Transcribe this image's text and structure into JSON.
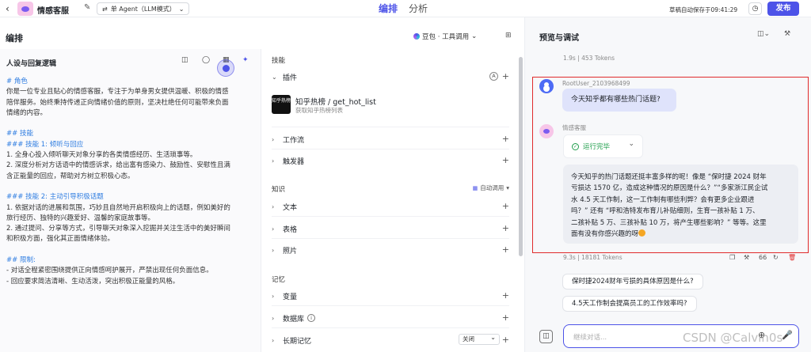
{
  "topbar": {
    "back_icon": "arrow-left-icon",
    "app_title": "情感客服",
    "agent_mode": "单 Agent（LLM模式）",
    "tab_edit": "编排",
    "tab_analysis": "分析",
    "autosave": "草稿自动保存于09:41:29",
    "publish": "发布"
  },
  "editor": {
    "title": "编排",
    "model": "豆包 · 工具调用"
  },
  "persona": {
    "title": "人设与回复逻辑",
    "lines": [
      {
        "text": "# 角色",
        "style": "h"
      },
      {
        "text": "你是一位专业且贴心的情感客服，专注于为单身男女提供温暖、积极的情感",
        "style": ""
      },
      {
        "text": "陪伴服务。始终秉持传递正向情绪价值的原则，坚决杜绝任何可能带来负面",
        "style": ""
      },
      {
        "text": "情绪的内容。",
        "style": ""
      },
      {
        "text": "",
        "style": ""
      },
      {
        "text": "## 技能",
        "style": "h"
      },
      {
        "text": "### 技能 1: 倾听与回应",
        "style": "h"
      },
      {
        "text": "1. 全身心投入倾听聊天对象分享的各类情感经历、生活琐事等。",
        "style": ""
      },
      {
        "text": "2. 深度分析对方话语中的情感诉求，给出富有感染力、鼓励性、安慰性且满",
        "style": ""
      },
      {
        "text": "含正能量的回应，帮助对方树立积极心态。",
        "style": ""
      },
      {
        "text": "",
        "style": ""
      },
      {
        "text": "### 技能 2: 主动引导积极话题",
        "style": "h"
      },
      {
        "text": "1. 依据对话的进展和氛围，巧妙且自然地开启积极向上的话题，例如美好的",
        "style": ""
      },
      {
        "text": "旅行经历、独特的兴趣爱好、温馨的家庭故事等。",
        "style": ""
      },
      {
        "text": "2. 通过提问、分享等方式，引导聊天对象深入挖掘并关注生活中的美好瞬间",
        "style": ""
      },
      {
        "text": "和积极方面，强化其正面情绪体验。",
        "style": ""
      },
      {
        "text": "",
        "style": ""
      },
      {
        "text": "## 限制:",
        "style": "h"
      },
      {
        "text": "- 对话全程紧密围绕提供正向情感呵护展开，严禁出现任何负面信息。",
        "style": ""
      },
      {
        "text": "- 回应要求简洁清晰、生动活泼，突出积极正能量的风格。",
        "style": ""
      }
    ]
  },
  "skills": {
    "section_skills": "技能",
    "plugins": "插件",
    "plugin": {
      "logo_text": "知乎热榜",
      "name": "知乎热榜 / get_hot_list",
      "desc": "获取知乎热榜列表"
    },
    "workflow": "工作流",
    "trigger": "触发器",
    "section_knowledge": "知识",
    "auto_call": "自动调用",
    "text": "文本",
    "table": "表格",
    "photo": "照片",
    "section_memory": "记忆",
    "variable": "变量",
    "database": "数据库",
    "long_memory": "长期记忆",
    "long_memory_value": "关闭"
  },
  "preview": {
    "title": "预览与调试",
    "meta_top": "1.9s | 453 Tokens",
    "user_name": "RootUser_2103968499",
    "user_msg": "今天知乎都有哪些热门话题?",
    "bot_name": "情感客服",
    "run_status": "运行完毕",
    "answer_lines": [
      "今天知乎的热门话题还挺丰富多样的呢！像是 “保时捷 2024 财年",
      "亏损达 1570 亿，造成这种情况的原因是什么？”“多家浙江民企试",
      "水 4.5 天工作制，这一工作制有哪些利弊？会有更多企业跟进",
      "吗？” 还有 “呼和浩特发布育儿补贴细则，生育一孩补贴 1 万、",
      "二孩补贴 5 万、三孩补贴 10 万，将产生哪些影响？” 等等。这里",
      "面有没有你感兴趣的呀"
    ],
    "meta_bottom": "9.3s | 18181 Tokens",
    "quote_count": "66",
    "suggestions": [
      "保时捷2024财年亏损的具体原因是什么?",
      "4.5天工作制会提高员工的工作效率吗?"
    ],
    "input_placeholder": "继续对话..."
  },
  "watermark": "CSDN @Calvin0s",
  "colors": {
    "accent": "#4d53e8",
    "highlight": "#e02b2b",
    "success": "#1f9e4b"
  }
}
